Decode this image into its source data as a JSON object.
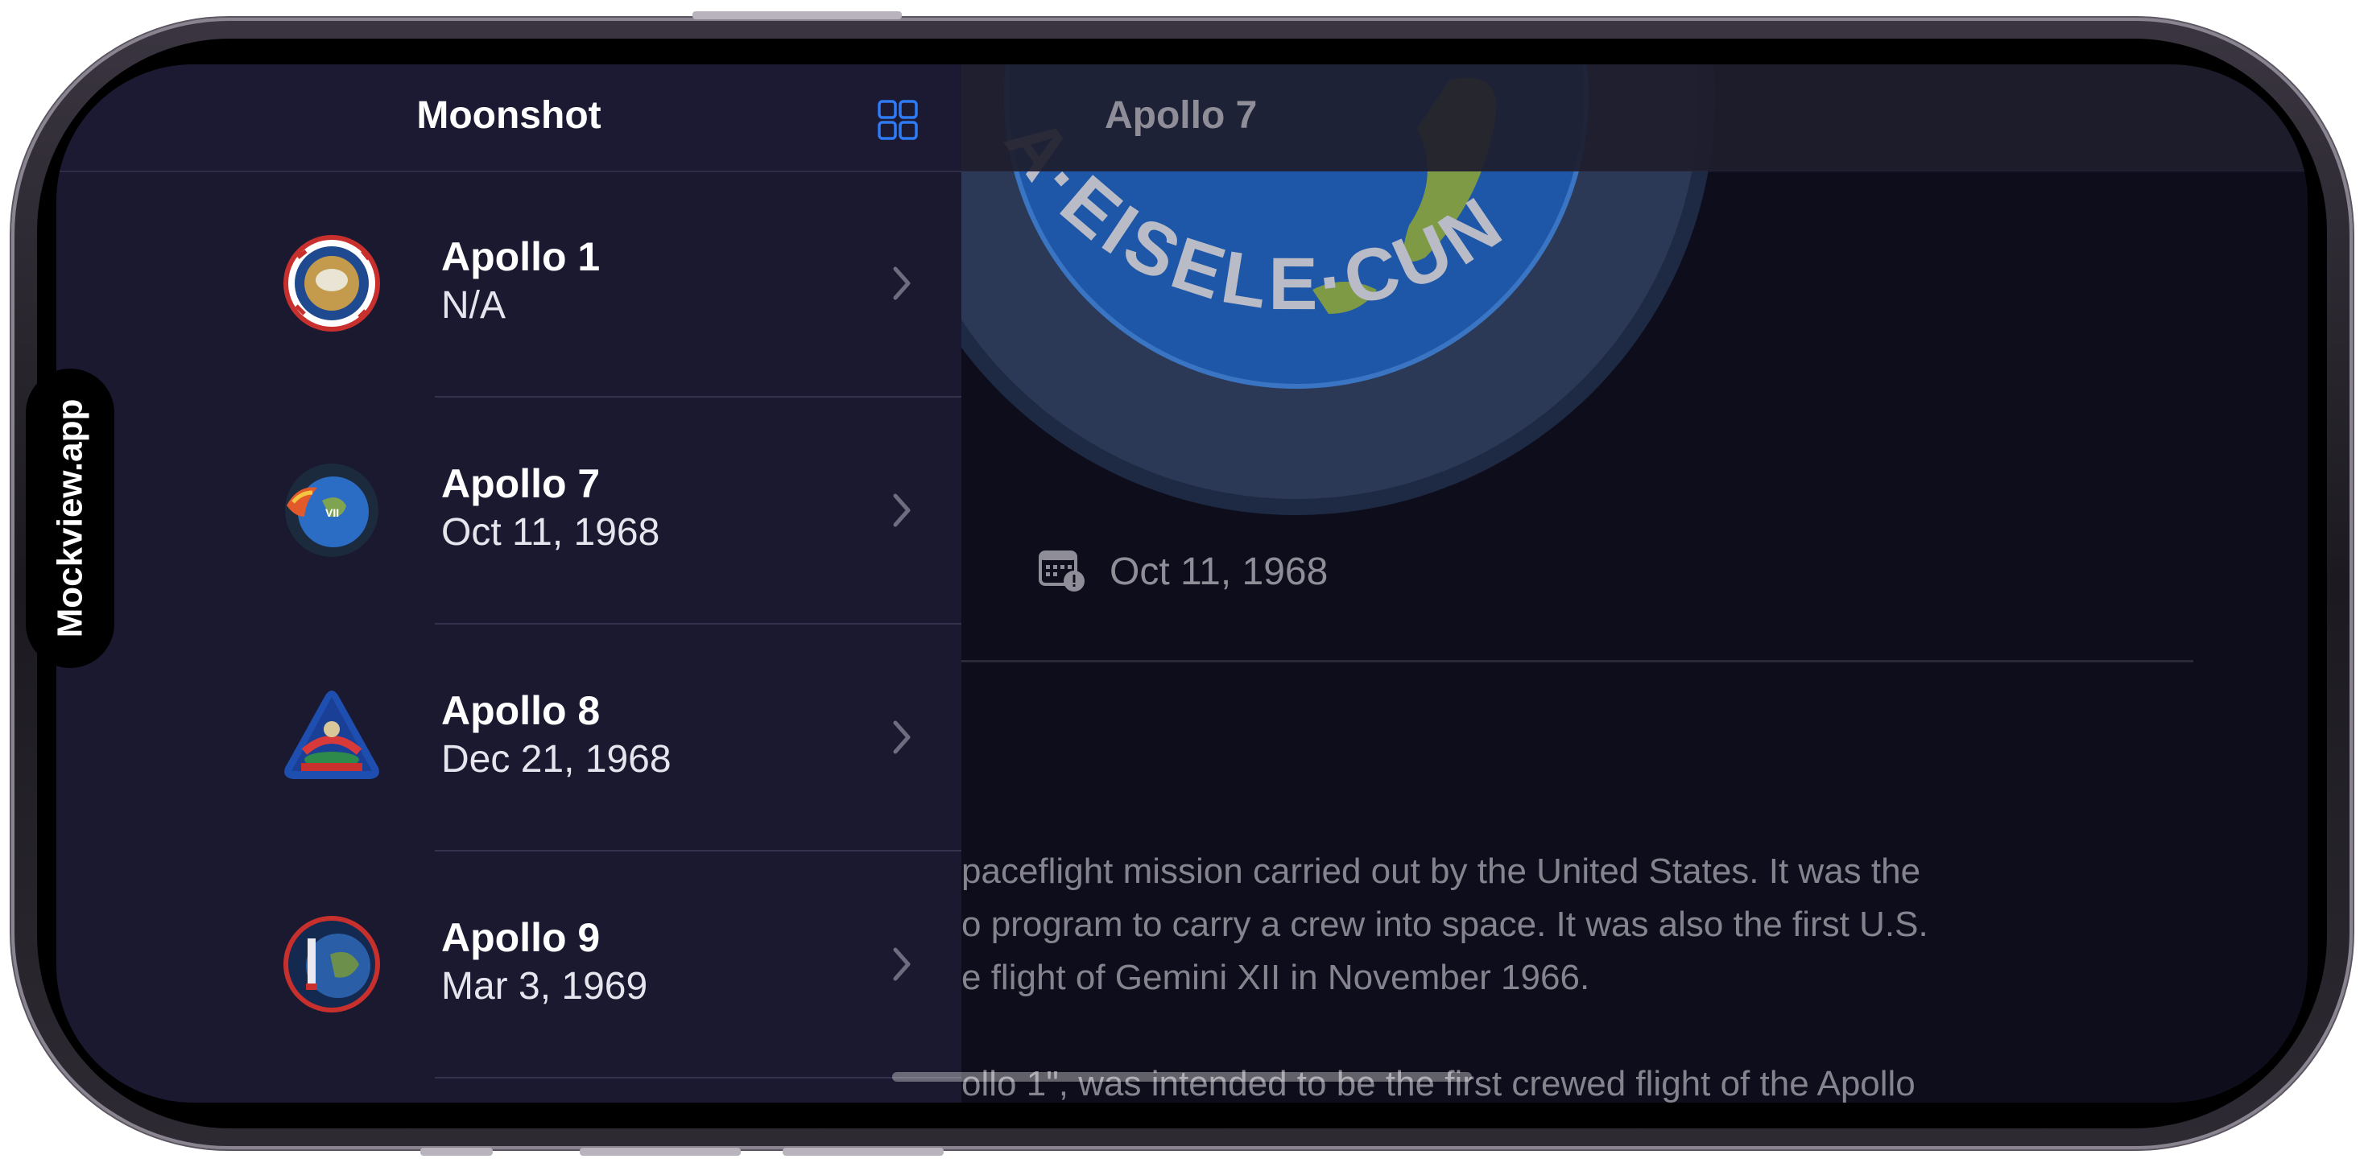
{
  "watermark": "Mockview.app",
  "sidebar": {
    "title": "Moonshot",
    "grid_icon": "grid-icon",
    "missions": [
      {
        "name": "Apollo 1",
        "date": "N/A"
      },
      {
        "name": "Apollo 7",
        "date": "Oct 11, 1968"
      },
      {
        "name": "Apollo 8",
        "date": "Dec 21, 1968"
      },
      {
        "name": "Apollo 9",
        "date": "Mar 3, 1969"
      }
    ]
  },
  "detail": {
    "title": "Apollo 7",
    "badge_text": "A·EISELE·CUN",
    "launch_date": "Oct 11, 1968",
    "description": [
      "paceflight mission carried out by the United States. It was the",
      "o program to carry a crew into space. It was also the first U.S.",
      "e flight of Gemini XII in November 1966.",
      "ollo 1\", was intended to be the first crewed flight of the Apollo"
    ]
  },
  "colors": {
    "accent": "#2f7bf5",
    "sidebar_bg": "#1a1930",
    "detail_bg": "#0e0d1b"
  }
}
